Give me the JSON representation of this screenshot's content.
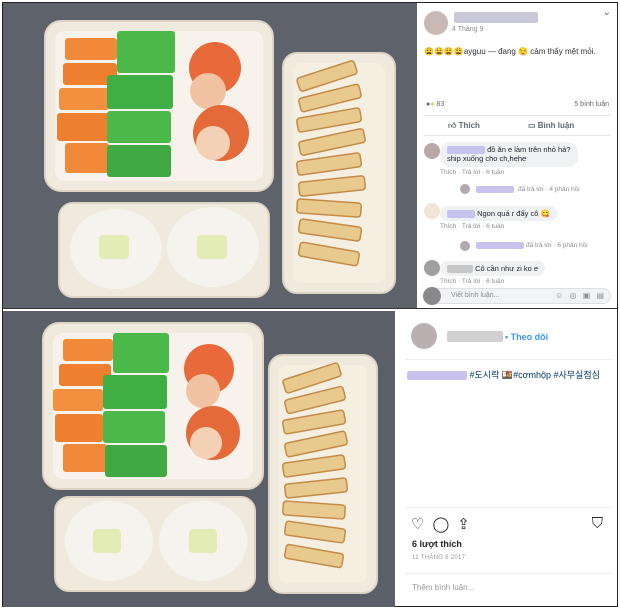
{
  "facebook_post": {
    "date": "4 Tháng 9 · ",
    "more_icon": "more-icon",
    "status_text": "😩😩😩😩ayguu — đang 😌 cảm thấy mệt mỏi.",
    "reaction_count": "83",
    "share_count": "5 bình luận",
    "like_label": "Thích",
    "comment_label": "Bình luận",
    "comments": [
      {
        "text_line1": "đồ ăn e làm trên nhỏ hả?",
        "text_line2": "ship xuống cho ch,hehe",
        "meta": "Thích · Trả lời · 6 tuần",
        "reply": "đã trả lời · 4 phản hồi"
      },
      {
        "text_line1": "Ngon quá r đấy cô 😋",
        "meta": "Thích · Trả lời · 6 tuần",
        "reply": "đã trả lời · 6 phản hồi"
      },
      {
        "text_line1": "Cô cần như zi ko e",
        "meta": "Thích · Trả lời · 6 tuần"
      }
    ],
    "comment_placeholder": "Viết bình luận...",
    "input_icons": "☺ ◎ ▣ ▤"
  },
  "instagram_post": {
    "follow_label": "• Theo dõi",
    "caption": "#도시락 🍱#cơmhộp #사무실점심",
    "likes": "6 lượt thích",
    "date": "11 THÁNG 8 2017",
    "add_comment_placeholder": "Thêm bình luận..."
  },
  "colors": {
    "fb_blue": "#4267b2",
    "ig_blue": "#3897f0",
    "carrot": "#f08a3a",
    "melon": "#4bb84a",
    "shrimp": "#e86a3a",
    "rice": "#f6f3ee",
    "bread": "#e8c98e",
    "background_gray": "#5d626b"
  }
}
